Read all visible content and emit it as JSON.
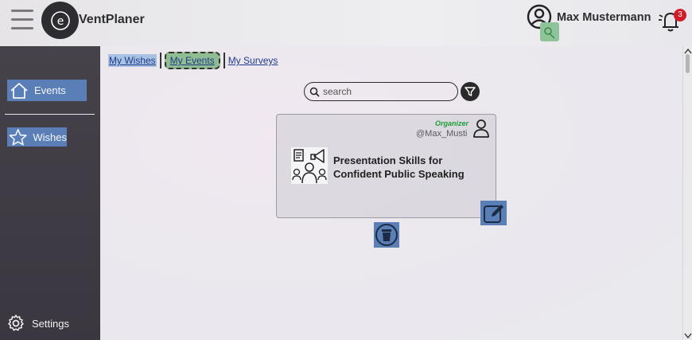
{
  "app": {
    "title": "VentPlaner"
  },
  "header": {
    "user_name": "Max Mustermann",
    "notification_count": "3"
  },
  "sidebar": {
    "items": [
      {
        "label": "Events",
        "icon": "home-icon"
      },
      {
        "label": "Wishes",
        "icon": "star-icon"
      }
    ],
    "settings_label": "Settings"
  },
  "tabs": [
    {
      "label": "My Wishes"
    },
    {
      "label": "My Events",
      "active": true
    },
    {
      "label": "My Surveys"
    }
  ],
  "search": {
    "placeholder": "search"
  },
  "event_card": {
    "organizer_label": "Organizer",
    "organizer_handle": "@Max_Musti",
    "title": "Presentation Skills for Confident Public Speaking"
  },
  "colors": {
    "accent": "#5a7fb6",
    "active_tab": "#8fbd91",
    "organizer_green": "#1e9e3b",
    "badge_red": "#d11d2a",
    "sidebar_bg": "#423e47"
  }
}
